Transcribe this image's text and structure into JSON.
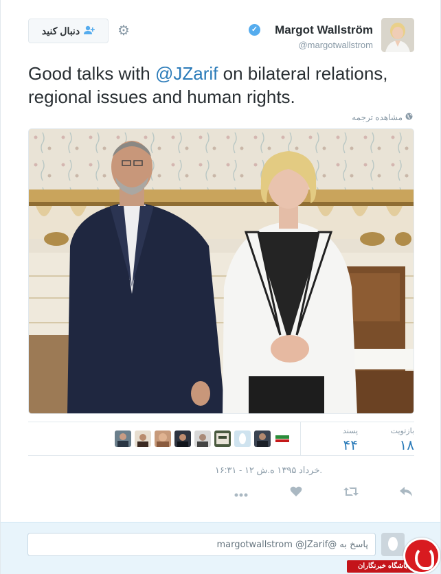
{
  "tweet": {
    "author": {
      "display_name": "Margot Wallström",
      "handle": "@margotwallstrom",
      "verified": true
    },
    "follow_label": "دنبال کنید",
    "text_before": "Good talks with ",
    "mention": "@JZarif",
    "text_after": " on bilateral relations, regional issues and human rights.",
    "translate_label": "مشاهده ترجمه",
    "stats": {
      "retweets_label": "بازتویت",
      "retweets_value": "۱۸",
      "likes_label": "پسند",
      "likes_value": "۴۴"
    },
    "timestamp": "۱۶:۳۱ - ۱۲ خرداد ۱۳۹۵ ه.ش."
  },
  "reply": {
    "value": "پاسخ به @margotwallstrom @JZarif"
  },
  "watermark": {
    "label": "باشگاه خبرنگاران"
  },
  "colors": {
    "link": "#2b7bb9",
    "verified": "#55acee",
    "muted": "#8899a6",
    "reply_bg": "#e8f4fb",
    "watermark_red": "#c4141a"
  },
  "icons": {
    "settings": "gear-icon",
    "follow": "add-user-icon",
    "translate": "globe-icon",
    "reply": "reply-icon",
    "retweet": "retweet-icon",
    "like": "heart-icon",
    "more": "more-icon"
  }
}
